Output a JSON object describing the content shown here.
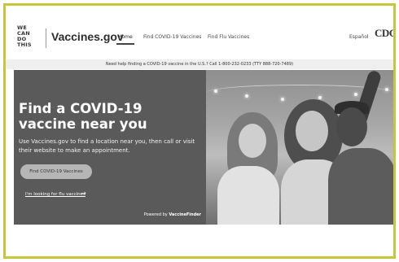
{
  "header": {
    "logo_lines": [
      "WE",
      "CAN",
      "DO",
      "THIS"
    ],
    "site_name": "Vaccines.gov",
    "nav": {
      "home": "Home",
      "find_covid": "Find COVID-19 Vaccines",
      "find_flu": "Find Flu Vaccines",
      "espanol": "Español"
    },
    "agency_logo": "CDC"
  },
  "banner": {
    "text": "Need help finding a COVID-19 vaccine in the U.S.? Call 1-800-232-0233 (TTY 888-720-7489)"
  },
  "hero": {
    "title": "Find a COVID-19 vaccine near you",
    "subtitle": "Use Vaccines.gov to find a location near you, then call or visit their website to make an appointment.",
    "button_label": "Find COVID-19 Vaccines",
    "flu_link": "I'm looking for flu vaccines",
    "arrow_glyph": "→",
    "powered_prefix": "Powered by",
    "powered_brand": "VaccineFinder"
  },
  "colors": {
    "frame_border": "#c9c43a",
    "hero_panel": "#5a5a5a",
    "button_bg": "#b6b6b6",
    "banner_bg": "#efefef"
  }
}
